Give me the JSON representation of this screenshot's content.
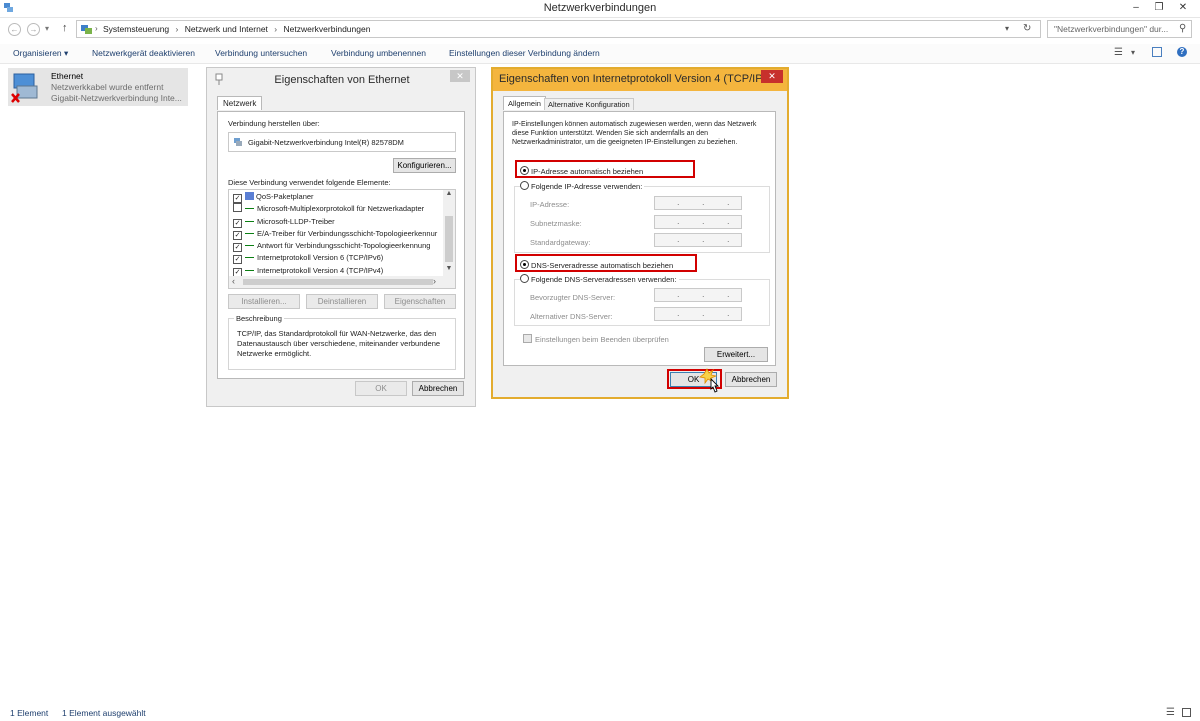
{
  "window": {
    "title": "Netzwerkverbindungen"
  },
  "address": {
    "crumbs": [
      "Systemsteuerung",
      "Netzwerk und Internet",
      "Netzwerkverbindungen"
    ],
    "search_placeholder": "\"Netzwerkverbindungen\" dur..."
  },
  "toolbar": {
    "items": [
      "Organisieren ▾",
      "Netzwerkgerät deaktivieren",
      "Verbindung untersuchen",
      "Verbindung umbenennen",
      "Einstellungen dieser Verbindung ändern"
    ]
  },
  "connection": {
    "name": "Ethernet",
    "status": "Netzwerkkabel wurde entfernt",
    "adapter": "Gigabit-Netzwerkverbindung Inte..."
  },
  "eth_dialog": {
    "title": "Eigenschaften von Ethernet",
    "tab": "Netzwerk",
    "connect_using_label": "Verbindung herstellen über:",
    "adapter": "Gigabit-Netzwerkverbindung Intel(R) 82578DM",
    "configure_button": "Konfigurieren...",
    "items_label": "Diese Verbindung verwendet folgende Elemente:",
    "items": [
      {
        "label": "QoS-Paketplaner",
        "checked": true
      },
      {
        "label": "Microsoft-Multiplexorprotokoll für Netzwerkadapter",
        "checked": false
      },
      {
        "label": "Microsoft-LLDP-Treiber",
        "checked": true
      },
      {
        "label": "E/A-Treiber für Verbindungsschicht-Topologieerkennur",
        "checked": true
      },
      {
        "label": "Antwort für Verbindungsschicht-Topologieerkennung",
        "checked": true
      },
      {
        "label": "Internetprotokoll Version 6 (TCP/IPv6)",
        "checked": true
      },
      {
        "label": "Internetprotokoll Version 4 (TCP/IPv4)",
        "checked": true
      }
    ],
    "install_button": "Installieren...",
    "uninstall_button": "Deinstallieren",
    "properties_button": "Eigenschaften",
    "description_title": "Beschreibung",
    "description": "TCP/IP, das Standardprotokoll für WAN-Netzwerke, das den Datenaustausch über verschiedene, miteinander verbundene Netzwerke ermöglicht.",
    "ok_button": "OK",
    "cancel_button": "Abbrechen"
  },
  "ipv4_dialog": {
    "title": "Eigenschaften von Internetprotokoll Version 4 (TCP/IP...",
    "tab_general": "Allgemein",
    "tab_alternate": "Alternative Konfiguration",
    "intro": "IP-Einstellungen können automatisch zugewiesen werden, wenn das Netzwerk diese Funktion unterstützt. Wenden Sie sich andernfalls an den Netzwerkadministrator, um die geeigneten IP-Einstellungen zu beziehen.",
    "auto_ip": "IP-Adresse automatisch beziehen",
    "manual_ip": "Folgende IP-Adresse verwenden:",
    "ip_label": "IP-Adresse:",
    "subnet_label": "Subnetzmaske:",
    "gateway_label": "Standardgateway:",
    "auto_dns": "DNS-Serveradresse automatisch beziehen",
    "manual_dns": "Folgende DNS-Serveradressen verwenden:",
    "preferred_dns_label": "Bevorzugter DNS-Server:",
    "alternate_dns_label": "Alternativer DNS-Server:",
    "ip_placeholder": ". . .",
    "validate_label": "Einstellungen beim Beenden überprüfen",
    "advanced_button": "Erweitert...",
    "ok_button": "OK",
    "cancel_button": "Abbrechen"
  },
  "status": {
    "count": "1 Element",
    "selected": "1 Element ausgewählt"
  }
}
